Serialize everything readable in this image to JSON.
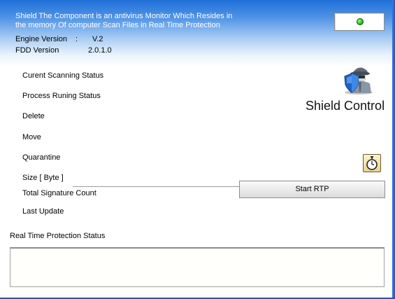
{
  "header": {
    "description_line1": "Shield The Component  is an antivirus Monitor Which Resides in",
    "description_line2": "the memory Of computer Scan Files in Real Time Protection"
  },
  "engine": {
    "label": "Engine Version",
    "separator": ":",
    "value": "V.2"
  },
  "fdd": {
    "label": "FDD Version",
    "value": "2.0.1.0"
  },
  "status_indicator": {
    "color": "#22c81e"
  },
  "status_labels": [
    "Curent Scanning Status",
    "Process Runing Status",
    "Delete",
    "Move",
    "Quarantine",
    "Size [ Byte ]",
    "Total Signature Count",
    "Last Update"
  ],
  "brand": {
    "title": "Shield Control",
    "logo_icon": "shield-spy-icon"
  },
  "timer_button": {
    "icon": "stopwatch-icon"
  },
  "start_rtp_button": {
    "label": "Start RTP"
  },
  "rtp_status": {
    "label": "Real Time Protection Status",
    "value": ""
  }
}
